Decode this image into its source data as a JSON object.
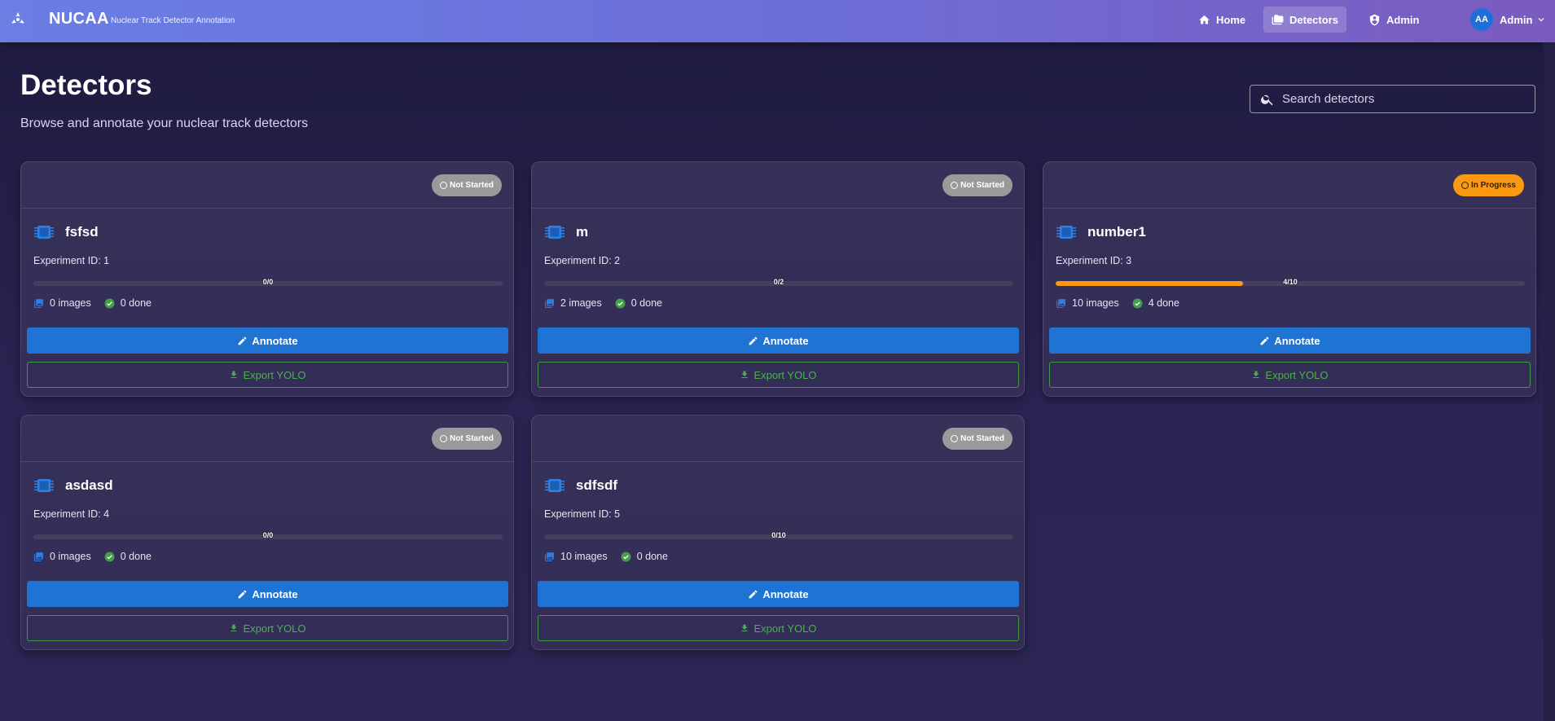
{
  "app": {
    "brand": "NUCAA",
    "subtitle": "Nuclear Track Detector Annotation"
  },
  "nav": {
    "home": "Home",
    "detectors": "Detectors",
    "admin": "Admin",
    "avatar_initials": "AA",
    "user": "Admin"
  },
  "page": {
    "title": "Detectors",
    "subtitle": "Browse and annotate your nuclear track detectors"
  },
  "search": {
    "placeholder": "Search detectors"
  },
  "colors": {
    "accent": "#1f73d3",
    "export": "#4caf50",
    "in_progress": "#fb9a12",
    "not_started": "#9a9a9a"
  },
  "cards": [
    {
      "title": "fsfsd",
      "status": "Not Started",
      "experiment": "Experiment ID: 1",
      "progress_label": "0/0",
      "progress": 0,
      "images": "0 images",
      "done": "0 done",
      "annotate": "Annotate",
      "export": "Export YOLO"
    },
    {
      "title": "m",
      "status": "Not Started",
      "experiment": "Experiment ID: 2",
      "progress_label": "0/2",
      "progress": 0,
      "images": "2 images",
      "done": "0 done",
      "annotate": "Annotate",
      "export": "Export YOLO"
    },
    {
      "title": "number1",
      "status": "In Progress",
      "experiment": "Experiment ID: 3",
      "progress_label": "4/10",
      "progress": 0.4,
      "images": "10 images",
      "done": "4 done",
      "annotate": "Annotate",
      "export": "Export YOLO"
    },
    {
      "title": "asdasd",
      "status": "Not Started",
      "experiment": "Experiment ID: 4",
      "progress_label": "0/0",
      "progress": 0,
      "images": "0 images",
      "done": "0 done",
      "annotate": "Annotate",
      "export": "Export YOLO"
    },
    {
      "title": "sdfsdf",
      "status": "Not Started",
      "experiment": "Experiment ID: 5",
      "progress_label": "0/10",
      "progress": 0,
      "images": "10 images",
      "done": "0 done",
      "annotate": "Annotate",
      "export": "Export YOLO"
    }
  ]
}
